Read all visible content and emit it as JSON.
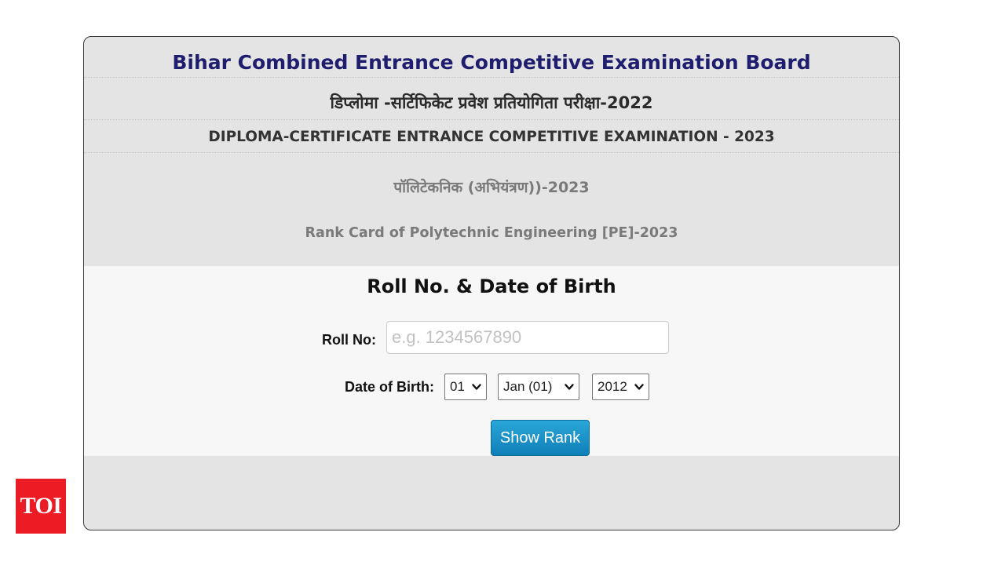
{
  "header": {
    "board_title": "Bihar Combined Entrance Competitive Examination Board",
    "hindi_exam_title": "डिप्लोमा -सर्टिफिकेट प्रवेश प्रतियोगिता परीक्षा-2022",
    "english_exam_title": "DIPLOMA-CERTIFICATE ENTRANCE COMPETITIVE EXAMINATION - 2023",
    "polytechnic_hindi": "पॉलिटेकनिक (अभियंत्रण))-2023",
    "rank_card_title": "Rank Card of Polytechnic Engineering [PE]-2023"
  },
  "form": {
    "heading": "Roll No. & Date of Birth",
    "roll_label": "Roll No:",
    "roll_value": "",
    "roll_placeholder": "e.g. 1234567890",
    "dob_label": "Date of Birth:",
    "dob_day": "01",
    "dob_month": "Jan (01)",
    "dob_year": "2012",
    "submit_label": "Show Rank"
  },
  "watermark": {
    "logo_text": "TOI",
    "logo_color": "#ec1c24"
  },
  "colors": {
    "title_navy": "#1f1d6e",
    "button_blue": "#1b93c9",
    "card_bg": "#e4e4e4",
    "form_bg": "#f7f7f8"
  },
  "icons": {
    "select_arrow": "chevron-down-icon"
  }
}
